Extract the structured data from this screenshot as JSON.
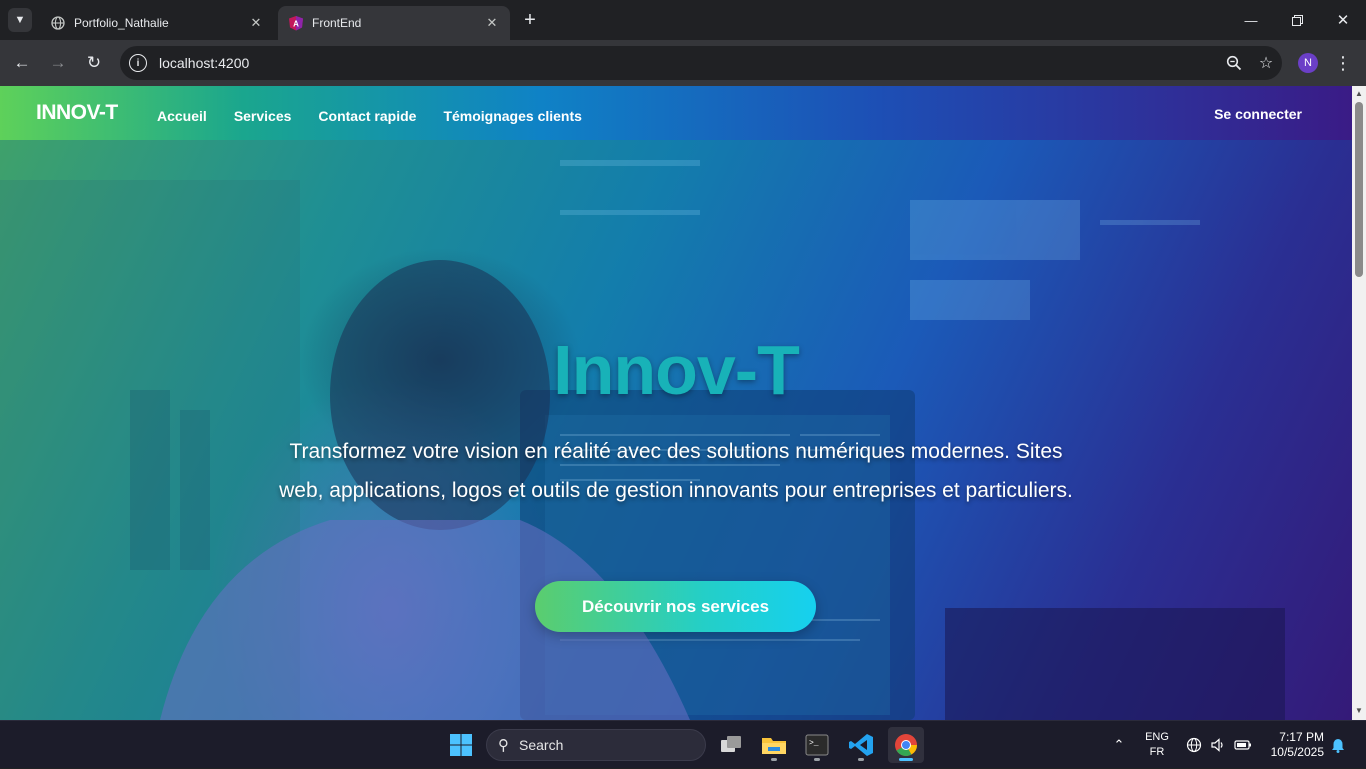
{
  "browser": {
    "tabs": [
      {
        "title": "Portfolio_Nathalie",
        "icon": "globe-icon",
        "active": false
      },
      {
        "title": "FrontEnd",
        "icon": "angular-icon",
        "active": true
      }
    ],
    "new_tab": "+",
    "url": "localhost:4200",
    "profile_initial": "N"
  },
  "site": {
    "brand": "INNOV-T",
    "nav": [
      "Accueil",
      "Services",
      "Contact rapide",
      "Témoignages clients"
    ],
    "login": "Se connecter"
  },
  "hero": {
    "title": "Innov-T",
    "subtitle": "Transformez votre vision en réalité avec des solutions numériques modernes. Sites web, applications, logos et outils de gestion innovants pour entreprises et particuliers.",
    "cta": "Découvrir nos services"
  },
  "taskbar": {
    "search_placeholder": "Search",
    "lang_primary": "ENG",
    "lang_secondary": "FR",
    "time": "7:17 PM",
    "date": "10/5/2025"
  },
  "colors": {
    "nav_gradient_start": "#5ed15a",
    "nav_gradient_end": "#3a1b86",
    "hero_title": "#18b2b8",
    "cta_start": "#5bcd6e",
    "cta_end": "#16d0ef"
  }
}
